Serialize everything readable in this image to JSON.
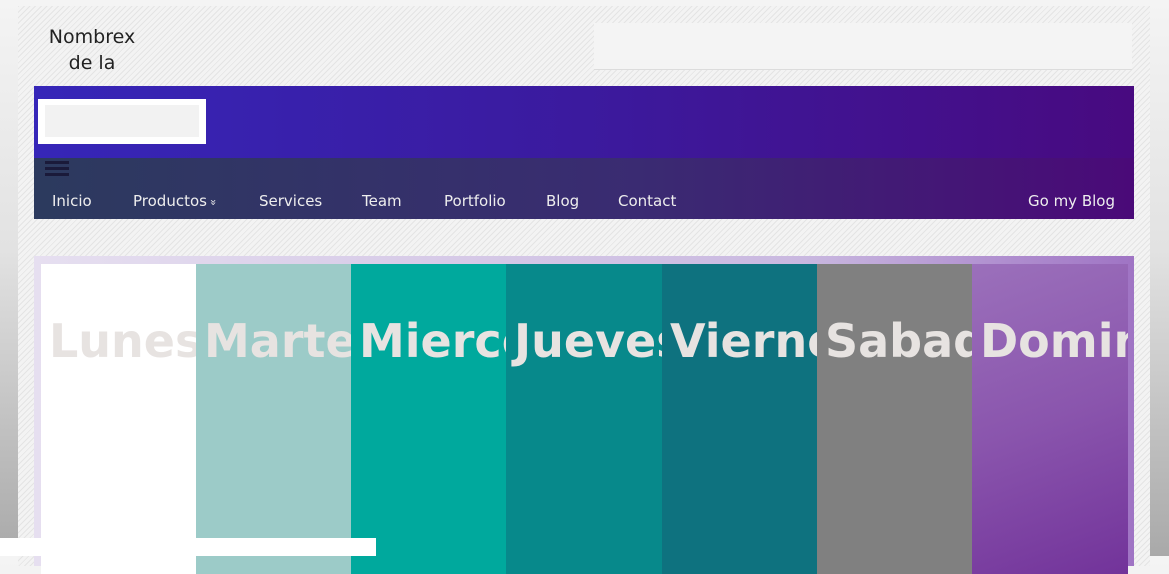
{
  "site": {
    "title_line1": "Nombrex",
    "title_line2": "de la"
  },
  "nav": {
    "menu_icon": "hamburger-icon",
    "items": [
      {
        "label": "Inicio"
      },
      {
        "label": "Productos",
        "icon": "double-chevron-down-icon",
        "icon_glyph": "»"
      },
      {
        "label": "Services"
      },
      {
        "label": "Team"
      },
      {
        "label": "Portfolio"
      },
      {
        "label": "Blog"
      },
      {
        "label": "Contact"
      }
    ],
    "right_link": "Go my Blog"
  },
  "days": [
    {
      "label": "Lunes",
      "color": "#ffffff"
    },
    {
      "label": "Martes",
      "color": "#9ccbc8"
    },
    {
      "label": "Mierco",
      "color": "#00a99d"
    },
    {
      "label": "Jueves",
      "color": "#07898b"
    },
    {
      "label": "Vierne",
      "color": "#0e727f"
    },
    {
      "label": "Sabad",
      "color": "#808080"
    },
    {
      "label": "Domin",
      "color": "#8e5eaf"
    }
  ]
}
